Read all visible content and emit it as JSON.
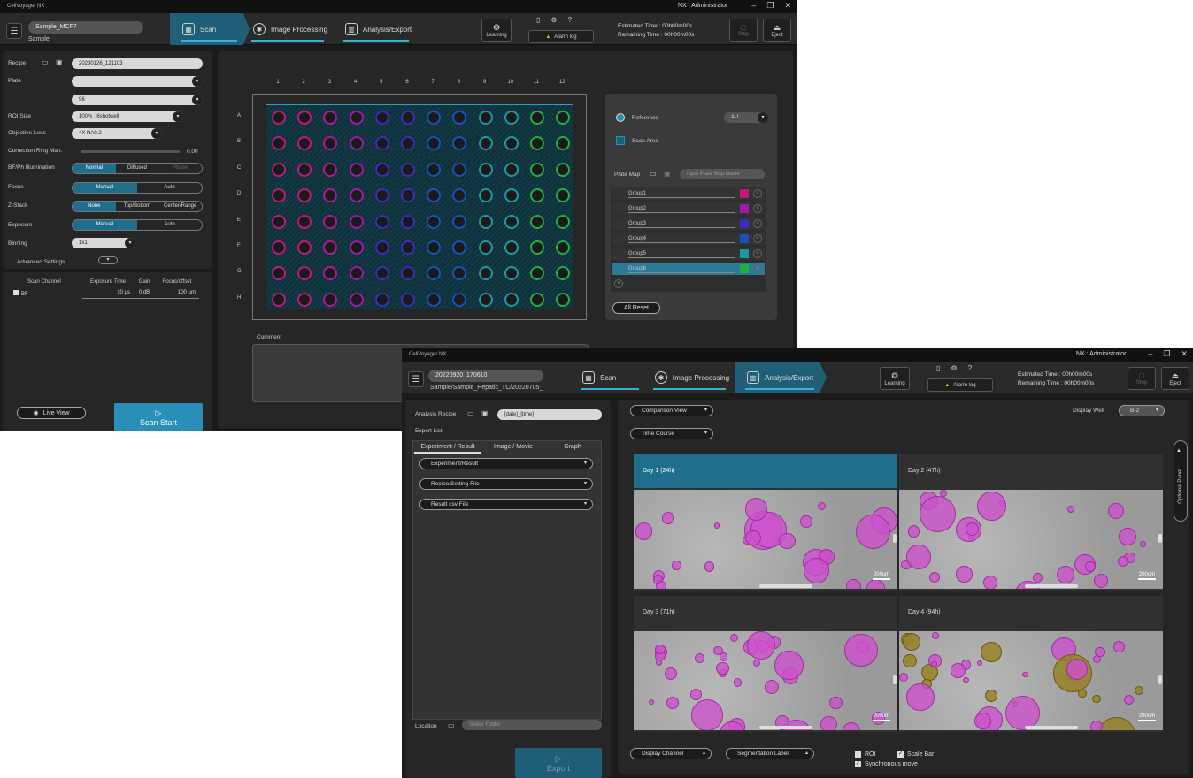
{
  "w1": {
    "title": "CellVoyager NX",
    "user": "NX : Administrator",
    "sample_name": "Sample_MCF7",
    "sample_label": "Sample",
    "steps": [
      "Scan",
      "Image Processing",
      "Analysis/Export"
    ],
    "learning": "Learning",
    "alarm": "Alarm log",
    "est_time": "Estimated Time : 00h00m00s",
    "rem_time": "Remaining Time : 00h00m00s",
    "stop": "Stop",
    "eject": "Eject",
    "left": {
      "recipe_label": "Recipe",
      "recipe_value": "20230126_121103",
      "plate_label": "Plate",
      "plate_value": "",
      "plate_type": "96",
      "roi_label": "ROI Size",
      "roi_value": "100% : 6shotwell",
      "objective_label": "Objective Lens",
      "objective_value": "4X NA0.2",
      "corr_label": "Correction Ring Man.",
      "corr_value": "0.00",
      "bf_label": "BF/Ph Illumination",
      "bf_opts": [
        "Normal",
        "Diffused",
        "Phase"
      ],
      "focus_label": "Focus",
      "focus_opts": [
        "Manual",
        "Auto"
      ],
      "zstack_label": "Z-Stack",
      "zstack_opts": [
        "None",
        "Top/Bottom",
        "Center/Range"
      ],
      "exposure_label": "Exposure",
      "exposure_opts": [
        "Manual",
        "Auto"
      ],
      "binning_label": "Binning",
      "binning_value": "1x1",
      "advanced": "Advanced Settings",
      "table_headers": [
        "Scan Channel",
        "Exposure Time",
        "Gain",
        "Focus/offset"
      ],
      "table_row": [
        "BF",
        "10 µs",
        "0 dB",
        "100 µm"
      ],
      "live_view": "Live View",
      "scan_start": "Scan Start"
    },
    "plate_cols": [
      "1",
      "2",
      "3",
      "4",
      "5",
      "6",
      "7",
      "8",
      "9",
      "10",
      "11",
      "12"
    ],
    "plate_rows": [
      "A",
      "B",
      "C",
      "D",
      "E",
      "F",
      "G",
      "H"
    ],
    "comment_label": "Comment",
    "right": {
      "reference": "Reference",
      "reference_value": "A-1",
      "scan_area": "Scan Area",
      "plate_map": "Plate Map",
      "plate_map_placeholder": "Input Plate Map Name",
      "groups": [
        {
          "name": "Group1",
          "color": "#c0187a"
        },
        {
          "name": "Group2",
          "color": "#a01aa8"
        },
        {
          "name": "Group3",
          "color": "#3a2cc0"
        },
        {
          "name": "Group4",
          "color": "#1a50b8"
        },
        {
          "name": "Group5",
          "color": "#1a9aa0"
        },
        {
          "name": "Group6",
          "color": "#20b040"
        }
      ],
      "all_reset": "All Reset"
    }
  },
  "w2": {
    "title": "CellVoyager NX",
    "user": "NX : Administrator",
    "sample_name": "20220920_170610",
    "sample_label": "Sample/Sample_Hepatic_TC/20220705_",
    "steps": [
      "Scan",
      "Image Processing",
      "Analysis/Export"
    ],
    "learning": "Learning",
    "alarm": "Alarm log",
    "est_time": "Estimated Time : 00h00m00s",
    "rem_time": "Remaining Time : 00h00m00s",
    "stop": "Stop",
    "eject": "Eject",
    "analysis_recipe": "Analysis Recipe",
    "recipe_value": "[date]_[time]",
    "export_list": "Export List",
    "tabs": [
      "Experiment / Result",
      "Image / Movie",
      "Graph"
    ],
    "export_items": [
      "Experiment/Result",
      "Recipe/Setting File",
      "Result csv File"
    ],
    "location": "Location",
    "location_placeholder": "Select Folder",
    "export_btn": "Export",
    "comparison_view": "Comparison View",
    "time_course": "Time Course",
    "display_well": "Display Well",
    "display_well_value": "B-2",
    "optional_panel": "Optional Panel",
    "days": [
      "Day 1 (24h)",
      "Day 2 (47h)",
      "Day 3 (71h)",
      "Day 4 (94h)"
    ],
    "scale": "200um",
    "display_channel": "Display Channel",
    "segmentation_label": "Segmentation Label",
    "roi": "ROI",
    "scale_bar": "Scale Bar",
    "sync_move": "Synchronous move"
  }
}
